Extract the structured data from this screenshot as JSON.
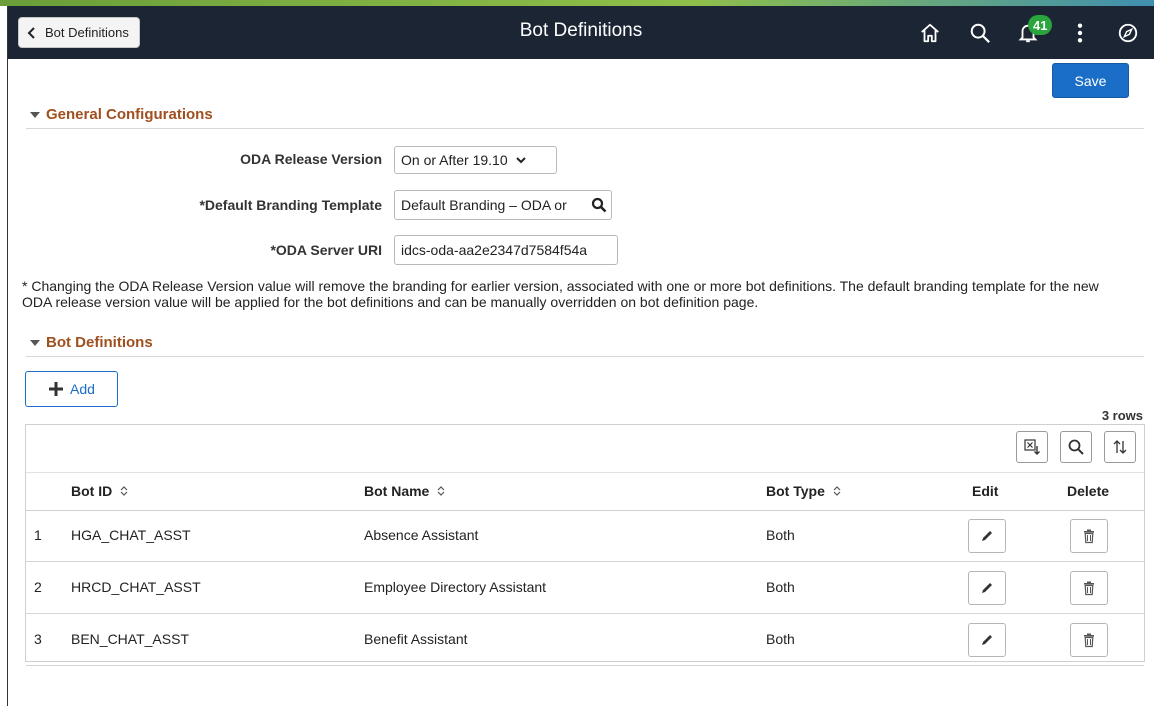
{
  "header": {
    "back_label": "Bot Definitions",
    "title": "Bot Definitions",
    "notifications_count": "41",
    "icons": [
      "home-icon",
      "search-icon",
      "notification-bell-icon",
      "actions-menu-icon",
      "navbar-icon"
    ],
    "bar_color": "#1b2533"
  },
  "toolbar": {
    "save_label": "Save"
  },
  "general": {
    "heading": "General Configurations",
    "oda_release_label": "ODA Release Version",
    "oda_release_value": "On or After 19.10",
    "branding_label": "*Default Branding Template",
    "branding_value": "Default Branding – ODA or",
    "server_uri_label": "*ODA Server URI",
    "server_uri_value": "idcs-oda-aa2e2347d7584f54a"
  },
  "note": "* Changing the ODA Release Version value will remove the branding for earlier version, associated with one or more bot definitions. The default branding template for the new ODA release version value will be applied for the bot definitions and can be manually overridden on bot definition page.",
  "bots": {
    "heading": "Bot Definitions",
    "add_label": "Add",
    "row_count": "3 rows",
    "columns": {
      "bot_id": "Bot ID",
      "bot_name": "Bot Name",
      "bot_type": "Bot Type",
      "edit": "Edit",
      "delete": "Delete"
    },
    "rows": [
      {
        "num": "1",
        "bot_id": "HGA_CHAT_ASST",
        "bot_name": "Absence Assistant",
        "bot_type": "Both"
      },
      {
        "num": "2",
        "bot_id": "HRCD_CHAT_ASST",
        "bot_name": "Employee Directory Assistant",
        "bot_type": "Both"
      },
      {
        "num": "3",
        "bot_id": "BEN_CHAT_ASST",
        "bot_name": "Benefit Assistant",
        "bot_type": "Both"
      }
    ]
  },
  "colors": {
    "accent": "#1a6ec7",
    "section_heading": "#a0501e",
    "badge": "#2aa43c"
  }
}
